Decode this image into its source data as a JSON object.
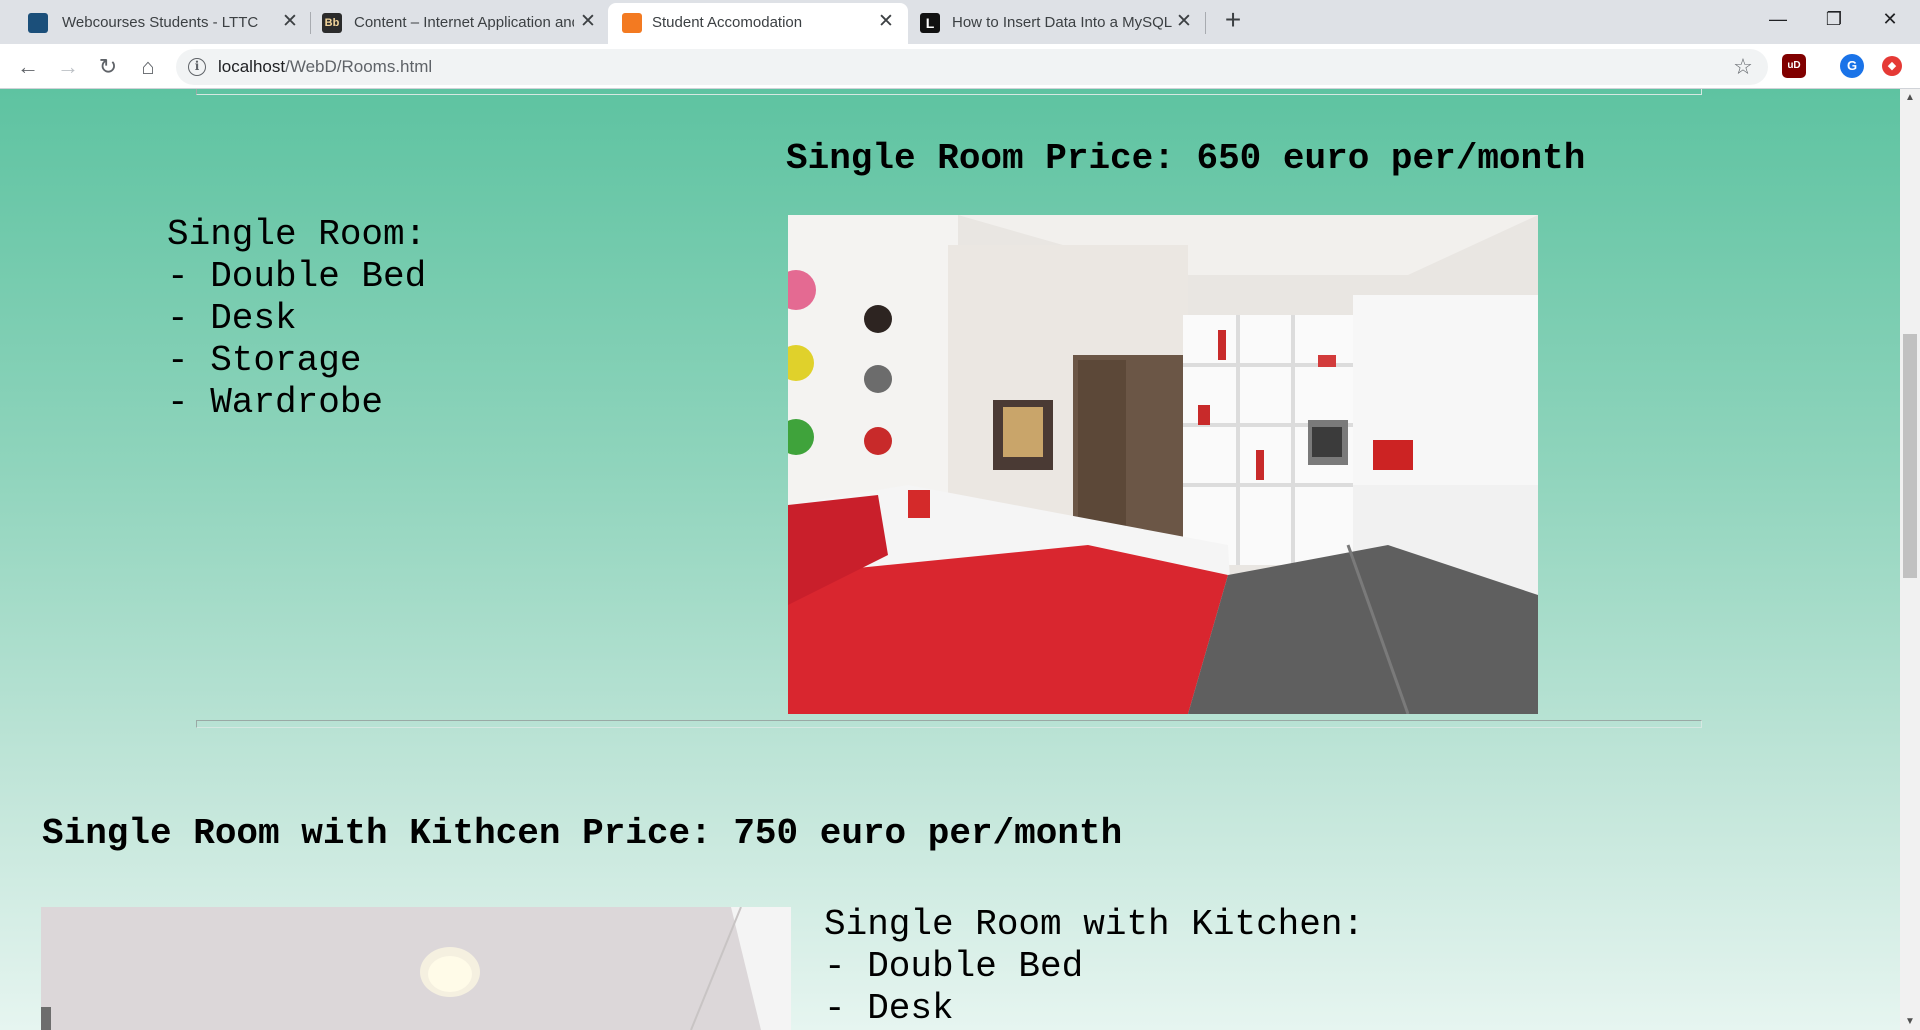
{
  "tabs": [
    {
      "title": "Webcourses Students - LTTC",
      "favicon": "webcourses-icon",
      "color": "#1b4f7a"
    },
    {
      "title": "Content – Internet Application and",
      "favicon": "blackboard-icon",
      "color": "#2b2b2b"
    },
    {
      "title": "Student Accomodation",
      "favicon": "xampp-icon",
      "color": "#f37a21"
    },
    {
      "title": "How to Insert Data Into a MySQL",
      "favicon": "letter-l-icon",
      "color": "#111111"
    }
  ],
  "address_bar": {
    "host": "localhost",
    "path": "/WebD/Rooms.html"
  },
  "extensions": [
    {
      "name": "ublock-icon",
      "label": "uD",
      "color": "#800000"
    },
    {
      "name": "profile-avatar",
      "label": "G",
      "color": "#1a73e8"
    },
    {
      "name": "extension-red-icon",
      "label": "◆",
      "color": "#e53935"
    }
  ],
  "single_room": {
    "price_heading": "Single Room Price: 650 euro per/month",
    "features": "Single Room:\n- Double Bed\n- Desk\n- Storage\n- Wardrobe"
  },
  "kitchen_room": {
    "price_heading": "Single Room with Kithcen Price: 750 euro per/month",
    "features": "Single Room with Kitchen:\n- Double Bed\n- Desk"
  }
}
